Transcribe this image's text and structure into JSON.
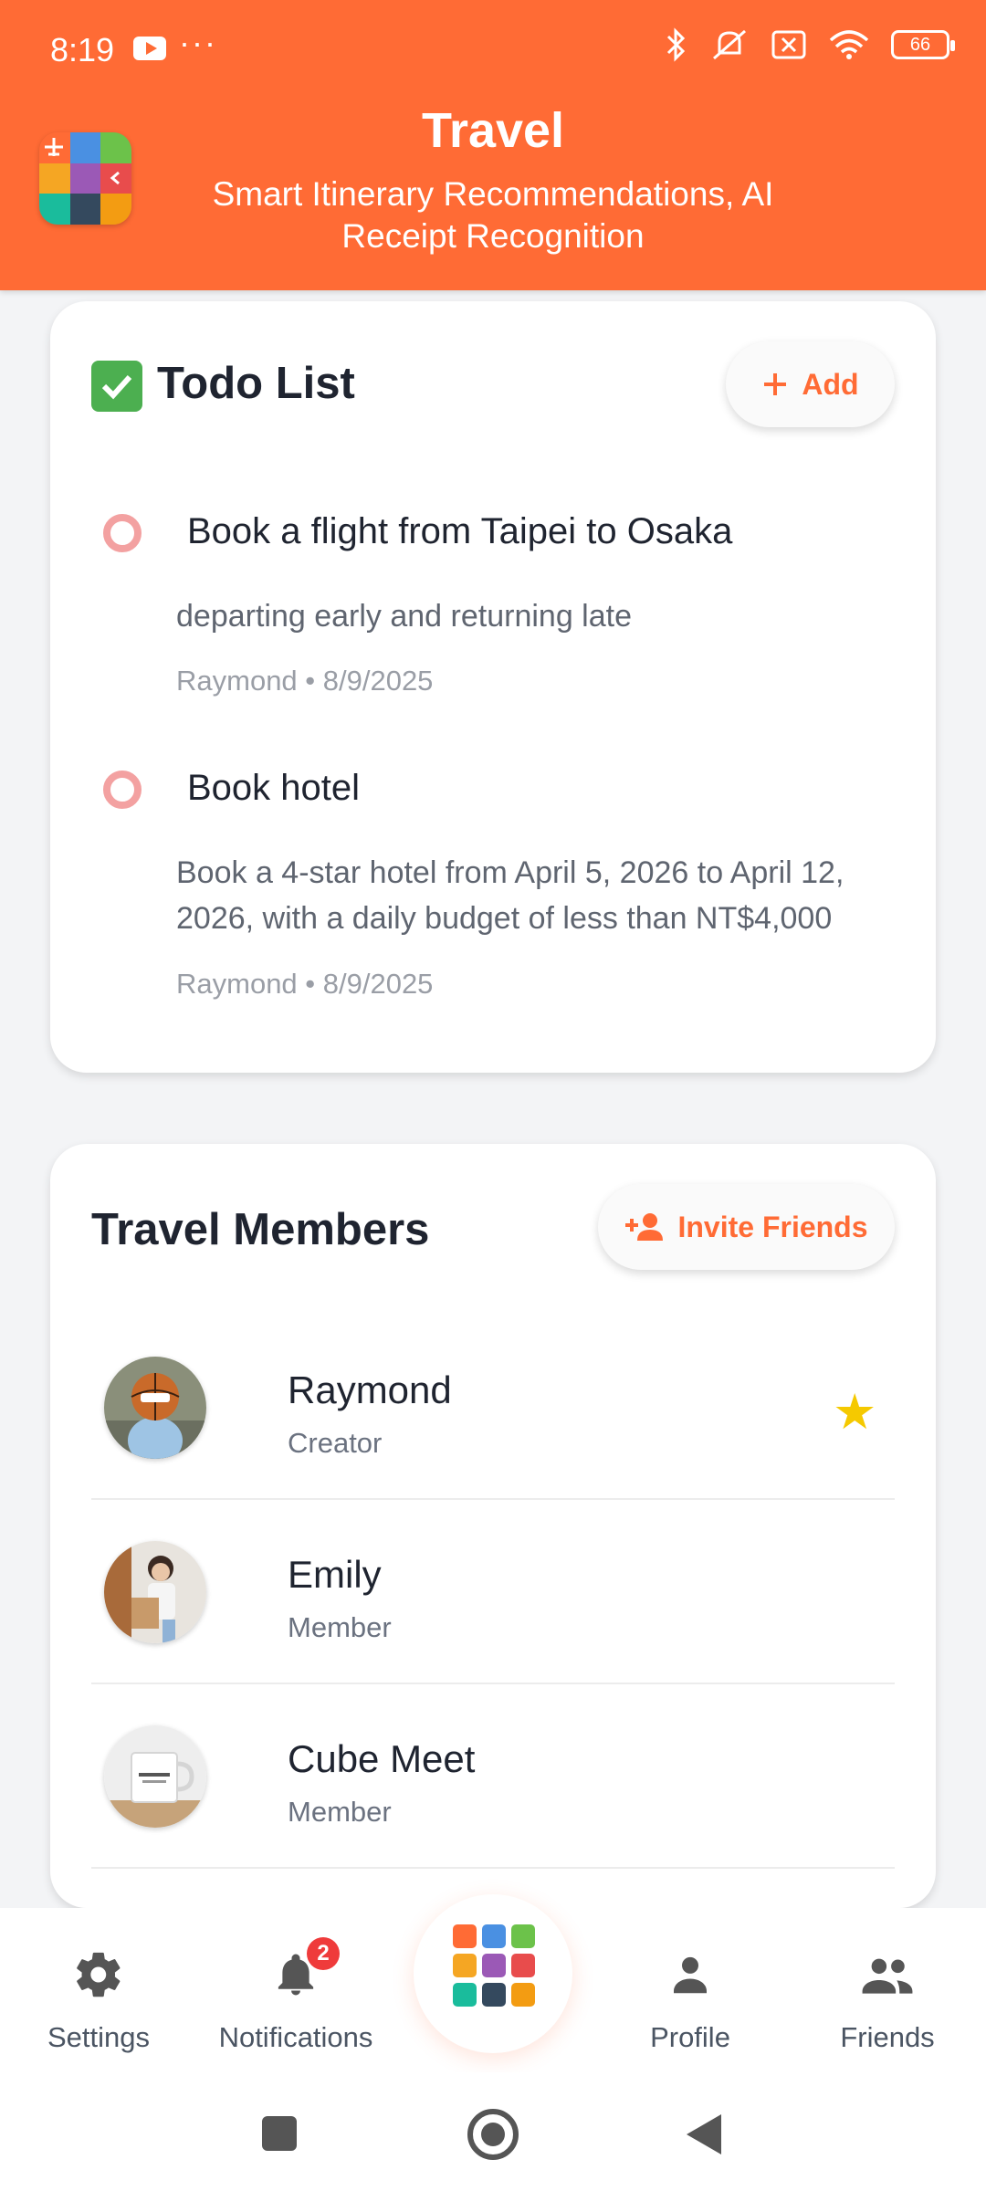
{
  "status_bar": {
    "time": "8:19",
    "more": "···",
    "battery": "66"
  },
  "header": {
    "title": "Travel",
    "subtitle": "Smart Itinerary Recommendations, AI Receipt Recognition"
  },
  "todo": {
    "title": "Todo List",
    "add_label": "Add",
    "items": [
      {
        "title": "Book a flight from Taipei to Osaka",
        "description": "departing early and returning late",
        "meta": "Raymond • 8/9/2025"
      },
      {
        "title": "Book hotel",
        "description": "Book a 4-star hotel from April 5, 2026 to April 12, 2026, with a daily budget of less than NT$4,000",
        "meta": "Raymond • 8/9/2025"
      }
    ]
  },
  "members": {
    "title": "Travel Members",
    "invite_label": "Invite Friends",
    "list": [
      {
        "name": "Raymond",
        "role": "Creator",
        "starred": true
      },
      {
        "name": "Emily",
        "role": "Member"
      },
      {
        "name": "Cube Meet",
        "role": "Member"
      }
    ]
  },
  "bottom_nav": {
    "settings": "Settings",
    "notifications": "Notifications",
    "notifications_badge": "2",
    "profile": "Profile",
    "friends": "Friends"
  },
  "colors": {
    "accent": "#ff6b35",
    "todo_circle": "#f3a1a1",
    "star": "#f5c900",
    "badge": "#ef3b3b"
  }
}
